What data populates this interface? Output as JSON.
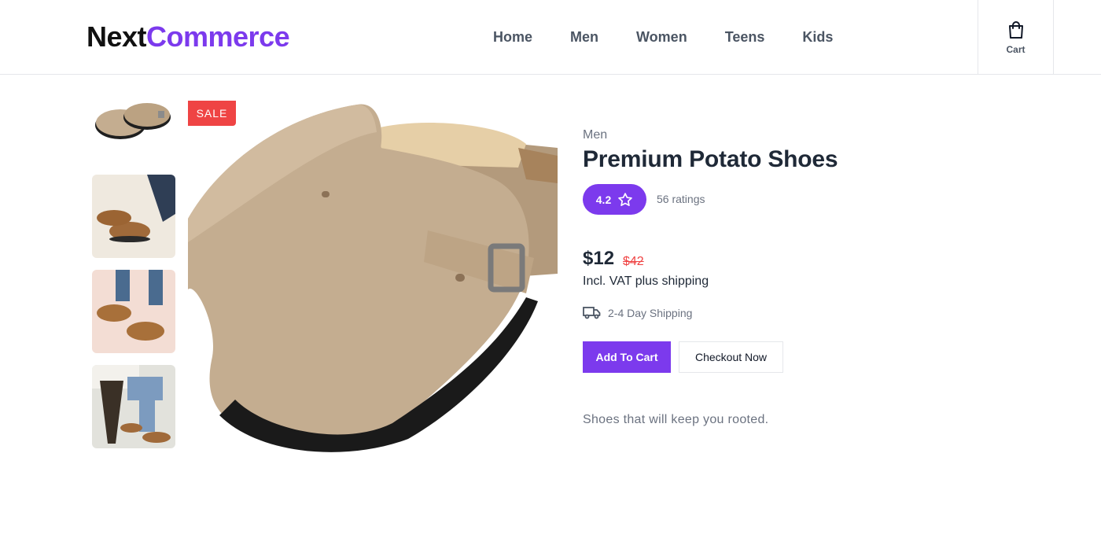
{
  "brand": {
    "part1": "Next",
    "part2": "Commerce"
  },
  "nav": {
    "items": [
      "Home",
      "Men",
      "Women",
      "Teens",
      "Kids"
    ]
  },
  "cart": {
    "label": "Cart",
    "icon": "shopping-bag-icon"
  },
  "product": {
    "badge": "SALE",
    "category": "Men",
    "title": "Premium Potato Shoes",
    "rating": "4.2",
    "ratings_count": "56 ratings",
    "price": "$12",
    "old_price": "$42",
    "vat_note": "Incl. VAT plus shipping",
    "shipping": "2-4 Day Shipping",
    "add_to_cart": "Add To Cart",
    "checkout": "Checkout Now",
    "description": "Shoes that will keep you rooted."
  },
  "colors": {
    "accent": "#7c3aed",
    "sale": "#ef4444",
    "suede": "#c4ad90"
  }
}
